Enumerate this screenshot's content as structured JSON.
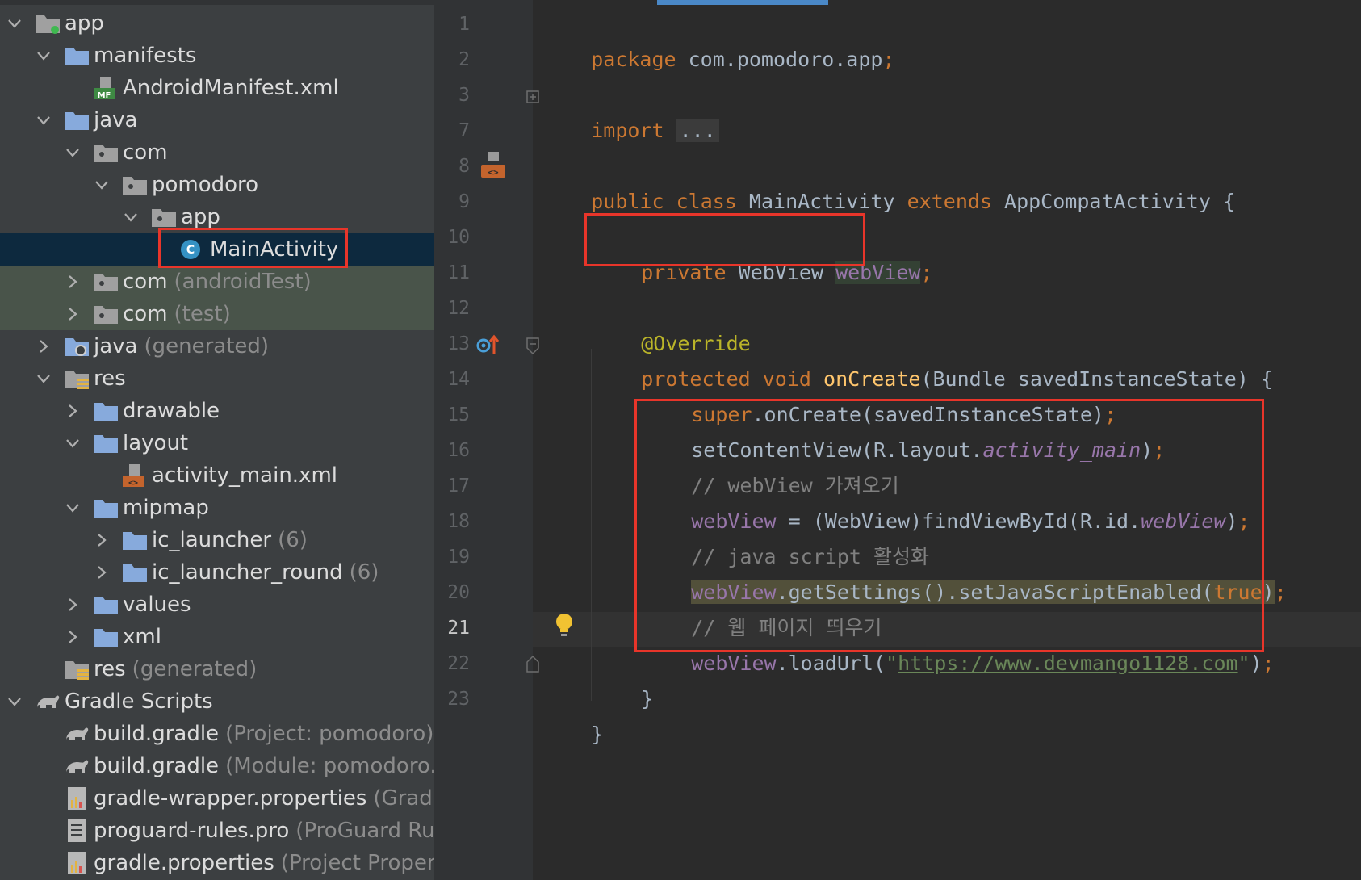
{
  "project_tree": {
    "items": [
      {
        "label": "app",
        "suffix": "",
        "icon": "module-folder-icon"
      },
      {
        "label": "manifests",
        "suffix": "",
        "icon": "folder-icon"
      },
      {
        "label": "AndroidManifest.xml",
        "suffix": "",
        "icon": "manifest-file-icon"
      },
      {
        "label": "java",
        "suffix": "",
        "icon": "folder-icon"
      },
      {
        "label": "com",
        "suffix": "",
        "icon": "package-icon"
      },
      {
        "label": "pomodoro",
        "suffix": "",
        "icon": "package-icon"
      },
      {
        "label": "app",
        "suffix": "",
        "icon": "package-icon"
      },
      {
        "label": "MainActivity",
        "suffix": "",
        "icon": "class-icon"
      },
      {
        "label": "com",
        "suffix": "(androidTest)",
        "icon": "package-icon"
      },
      {
        "label": "com",
        "suffix": "(test)",
        "icon": "package-icon"
      },
      {
        "label": "java",
        "suffix": "(generated)",
        "icon": "generated-folder-icon"
      },
      {
        "label": "res",
        "suffix": "",
        "icon": "resource-folder-icon"
      },
      {
        "label": "drawable",
        "suffix": "",
        "icon": "folder-icon"
      },
      {
        "label": "layout",
        "suffix": "",
        "icon": "folder-icon"
      },
      {
        "label": "activity_main.xml",
        "suffix": "",
        "icon": "layout-file-icon"
      },
      {
        "label": "mipmap",
        "suffix": "",
        "icon": "folder-icon"
      },
      {
        "label": "ic_launcher",
        "suffix": "(6)",
        "icon": "folder-icon"
      },
      {
        "label": "ic_launcher_round",
        "suffix": "(6)",
        "icon": "folder-icon"
      },
      {
        "label": "values",
        "suffix": "",
        "icon": "folder-icon"
      },
      {
        "label": "xml",
        "suffix": "",
        "icon": "folder-icon"
      },
      {
        "label": "res",
        "suffix": "(generated)",
        "icon": "resource-folder-icon"
      },
      {
        "label": "Gradle Scripts",
        "suffix": "",
        "icon": "gradle-icon"
      },
      {
        "label": "build.gradle",
        "suffix": "(Project: pomodoro)",
        "icon": "gradle-icon"
      },
      {
        "label": "build.gradle",
        "suffix": "(Module: pomodoro.a",
        "icon": "gradle-icon"
      },
      {
        "label": "gradle-wrapper.properties",
        "suffix": "(Gradle",
        "icon": "properties-file-icon"
      },
      {
        "label": "proguard-rules.pro",
        "suffix": "(ProGuard Rule",
        "icon": "text-file-icon"
      },
      {
        "label": "gradle.properties",
        "suffix": "(Project Propert",
        "icon": "properties-file-icon"
      }
    ]
  },
  "editor": {
    "line_numbers": [
      "1",
      "2",
      "3",
      "7",
      "8",
      "9",
      "10",
      "11",
      "12",
      "13",
      "14",
      "15",
      "16",
      "17",
      "18",
      "19",
      "20",
      "21",
      "22",
      "23"
    ],
    "current_line": "21",
    "code": {
      "l1": {
        "kw": "package",
        "rest": " com.pomodoro.app",
        "semi": ";"
      },
      "l3": {
        "kw": "import",
        "fold": "..."
      },
      "l8": {
        "kw1": "public",
        "kw2": "class",
        "cls": "MainActivity",
        "kw3": "extends",
        "parent": "AppCompatActivity",
        "brace": "{"
      },
      "l10": {
        "kw": "private",
        "type": "WebView",
        "field": "webView",
        "semi": ";"
      },
      "l12": {
        "ann": "@Override"
      },
      "l13": {
        "kw1": "protected",
        "kw2": "void",
        "method": "onCreate",
        "params": "(Bundle savedInstanceState) {"
      },
      "l14": {
        "kw": "super",
        "rest": ".onCreate(savedInstanceState)",
        "semi": ";"
      },
      "l15": {
        "a": "setContentView(R.layout.",
        "field": "activity_main",
        "b": ")",
        "semi": ";"
      },
      "l16": {
        "comment": "// webView 가져오기"
      },
      "l17": {
        "field": "webView",
        "a": " = (WebView)findViewById(R.id.",
        "field2": "webView",
        "b": ")",
        "semi": ";"
      },
      "l18": {
        "comment": "// java script 활성화"
      },
      "l19": {
        "field": "webView",
        "a": ".getSettings().setJavaScriptEnabled(",
        "kw": "true",
        "b": ")",
        "semi": ";"
      },
      "l20": {
        "comment": "// 웹 페이지 띄우기"
      },
      "l21": {
        "field": "webView",
        "a": ".loadUrl(",
        "q1": "\"",
        "url": "https://www.devmango1128.com",
        "q2": "\"",
        "b": ")",
        "semi": ";"
      },
      "l22": {
        "brace": "}"
      },
      "l23": {
        "brace": "}"
      }
    }
  },
  "colors": {
    "highlight_box": "#e8352a",
    "keyword": "#cc7832",
    "field": "#9876aa",
    "string": "#6a8759",
    "annotation": "#bbb529",
    "method": "#ffc66d"
  }
}
